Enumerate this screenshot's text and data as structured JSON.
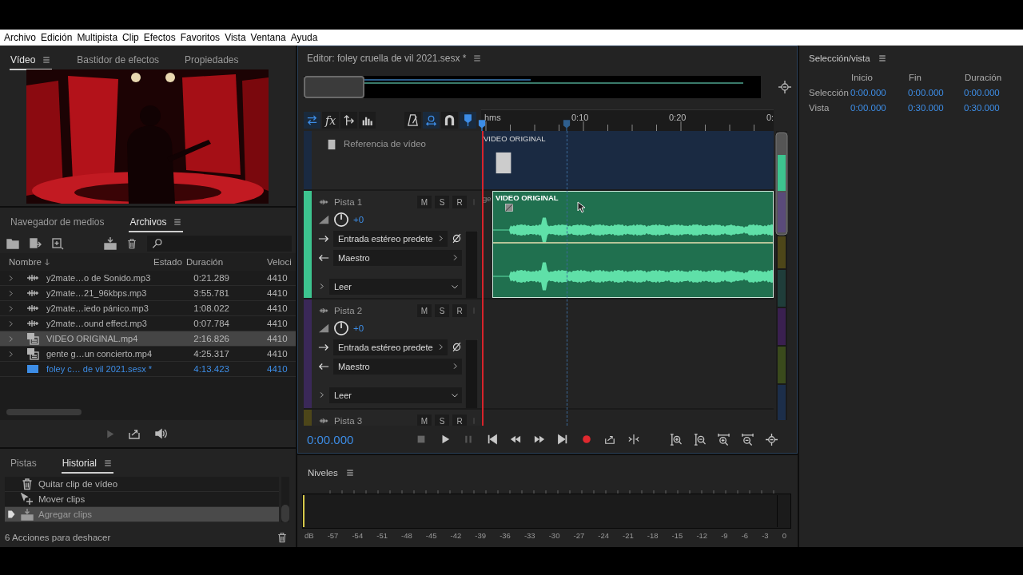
{
  "menu": [
    "Archivo",
    "Edición",
    "Multipista",
    "Clip",
    "Efectos",
    "Favoritos",
    "Vista",
    "Ventana",
    "Ayuda"
  ],
  "video_panel": {
    "tabs": [
      {
        "label": "Vídeo",
        "selected": true
      },
      {
        "label": "Bastidor de efectos",
        "selected": false
      },
      {
        "label": "Propiedades",
        "selected": false
      }
    ]
  },
  "files_panel": {
    "tabs": [
      {
        "label": "Navegador de medios",
        "selected": false
      },
      {
        "label": "Archivos",
        "selected": true
      }
    ],
    "columns": [
      "Nombre",
      "Estado",
      "Duración",
      "Veloci"
    ],
    "rows": [
      {
        "name": "y2mate…o de Sonido.mp3",
        "duration": "0:21.289",
        "rate": "4410",
        "kind": "audio",
        "expandable": true,
        "selected": false,
        "current": false
      },
      {
        "name": "y2mate…21_96kbps.mp3",
        "duration": "3:55.781",
        "rate": "4410",
        "kind": "audio",
        "expandable": true,
        "selected": false,
        "current": false
      },
      {
        "name": "y2mate…iedo pánico.mp3",
        "duration": "1:08.022",
        "rate": "4410",
        "kind": "audio",
        "expandable": true,
        "selected": false,
        "current": false
      },
      {
        "name": "y2mate…ound effect.mp3",
        "duration": "0:07.784",
        "rate": "4410",
        "kind": "audio",
        "expandable": true,
        "selected": false,
        "current": false
      },
      {
        "name": "VIDEO ORIGINAL.mp4",
        "duration": "2:16.826",
        "rate": "4410",
        "kind": "video",
        "expandable": true,
        "selected": true,
        "current": false
      },
      {
        "name": "gente g…un concierto.mp4",
        "duration": "4:25.317",
        "rate": "4410",
        "kind": "video",
        "expandable": true,
        "selected": false,
        "current": false
      },
      {
        "name": "foley c… de vil 2021.sesx *",
        "duration": "4:13.423",
        "rate": "4410",
        "kind": "session",
        "expandable": false,
        "selected": false,
        "current": true
      }
    ]
  },
  "history_panel": {
    "tabs": [
      {
        "label": "Pistas",
        "selected": false
      },
      {
        "label": "Historial",
        "selected": true
      }
    ],
    "items": [
      {
        "label": "Quitar clip de vídeo",
        "kind": "delete",
        "selected": false
      },
      {
        "label": "Mover clips",
        "kind": "move",
        "selected": false
      },
      {
        "label": "Agregar clips",
        "kind": "add",
        "selected": true
      }
    ],
    "footer": "6 Acciones para deshacer"
  },
  "editor": {
    "title": "Editor: foley cruella de vil 2021.sesx *",
    "tools": [
      {
        "kind": "swap",
        "on": true
      },
      {
        "kind": "fx",
        "glyph": "fx",
        "on": false
      },
      {
        "kind": "send",
        "on": false
      },
      {
        "kind": "eq",
        "on": false
      }
    ],
    "tools2": [
      {
        "kind": "metronome",
        "on": false
      },
      {
        "kind": "loop",
        "on": true
      },
      {
        "kind": "magnet",
        "on": false
      },
      {
        "kind": "marker",
        "on": true
      }
    ],
    "ruler": [
      "hms",
      "0:10",
      "0:20",
      "0:"
    ],
    "video_track": {
      "label": "Referencia de vídeo",
      "clip": "VIDEO ORIGINAL"
    },
    "tracks": [
      {
        "name": "Pista 1",
        "color": "#3dc48f",
        "buttons": [
          "M",
          "S",
          "R"
        ],
        "volume": "+0",
        "input": "Entrada estéreo predete",
        "output": "Maestro",
        "automation": "Leer",
        "clip": {
          "title": "VIDEO ORIGINAL",
          "behind_label": "ge"
        }
      },
      {
        "name": "Pista 2",
        "color": "#3a2858",
        "buttons": [
          "M",
          "S",
          "R"
        ],
        "volume": "+0",
        "input": "Entrada estéreo predete",
        "output": "Maestro",
        "automation": "Leer"
      },
      {
        "name": "Pista 3",
        "color": "#4d4619",
        "buttons": [
          "M",
          "S",
          "R"
        ]
      }
    ],
    "time": "0:00.000"
  },
  "levels": {
    "title": "Niveles",
    "scale": [
      "dB",
      "-57",
      "-54",
      "-51",
      "-48",
      "-45",
      "-42",
      "-39",
      "-36",
      "-33",
      "-30",
      "-27",
      "-24",
      "-21",
      "-18",
      "-15",
      "-12",
      "-9",
      "-6",
      "-3",
      "0"
    ]
  },
  "selection": {
    "title": "Selección/vista",
    "columns": [
      "Inicio",
      "Fin",
      "Duración"
    ],
    "rows": [
      {
        "label": "Selección",
        "values": [
          "0:00.000",
          "0:00.000",
          "0:00.000"
        ]
      },
      {
        "label": "Vista",
        "values": [
          "0:00.000",
          "0:30.000",
          "0:30.000"
        ]
      }
    ]
  }
}
